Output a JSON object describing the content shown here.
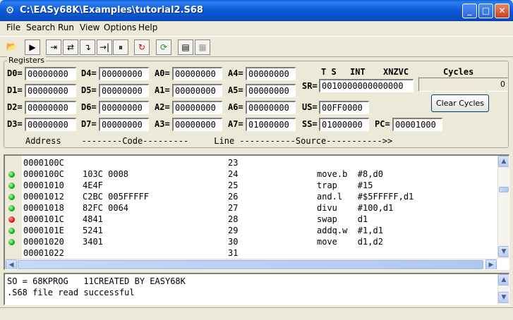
{
  "window": {
    "title": "C:\\EASy68K\\Examples\\tutorial2.S68",
    "icon": "gear-icon",
    "controls": {
      "minimize": "_",
      "maximize": "□",
      "close": "✕"
    }
  },
  "menu": [
    "File",
    "Search",
    "Run",
    "View",
    "Options",
    "Help"
  ],
  "toolbar": {
    "icons": [
      "open-folder-icon",
      "run-icon",
      "step-into-icon",
      "step-over-icon",
      "trace-into-icon",
      "run-to-cursor-icon",
      "pause-icon",
      "reset-icon",
      "reload-icon",
      "log-icon",
      "log-stop-icon"
    ],
    "glyphs": [
      "📂",
      "▶",
      "⇥",
      "⇄",
      "↴",
      "→|",
      "⏸",
      "↻",
      "⟳",
      "▤",
      "▦"
    ]
  },
  "registers": {
    "group_label": "Registers",
    "D0": {
      "label": "D0=",
      "value": "00000000"
    },
    "D1": {
      "label": "D1=",
      "value": "00000000"
    },
    "D2": {
      "label": "D2=",
      "value": "00000000"
    },
    "D3": {
      "label": "D3=",
      "value": "00000000"
    },
    "D4": {
      "label": "D4=",
      "value": "00000000"
    },
    "D5": {
      "label": "D5=",
      "value": "00000000"
    },
    "D6": {
      "label": "D6=",
      "value": "00000000"
    },
    "D7": {
      "label": "D7=",
      "value": "00000000"
    },
    "A0": {
      "label": "A0=",
      "value": "00000000"
    },
    "A1": {
      "label": "A1=",
      "value": "00000000"
    },
    "A2": {
      "label": "A2=",
      "value": "00000000"
    },
    "A3": {
      "label": "A3=",
      "value": "00000000"
    },
    "A4": {
      "label": "A4=",
      "value": "00000000"
    },
    "A5": {
      "label": "A5=",
      "value": "00000000"
    },
    "A6": {
      "label": "A6=",
      "value": "00000000"
    },
    "A7": {
      "label": "A7=",
      "value": "01000000"
    },
    "SR": {
      "label": "SR=",
      "value": "0010000000000000"
    },
    "US": {
      "label": "US=",
      "value": "00FF0000"
    },
    "SS": {
      "label": "SS=",
      "value": "01000000"
    },
    "PC": {
      "label": "PC=",
      "value": "00001000"
    },
    "sr_header": {
      "ts": "T S",
      "int": "INT",
      "flags": "XNZVC"
    }
  },
  "cycles": {
    "label": "Cycles",
    "value": "0",
    "clear_button": "Clear Cycles"
  },
  "listing": {
    "column_header": "Address    --------Code---------     Line -----------Source----------->>",
    "rows": [
      {
        "addr": "0000100C",
        "code": "",
        "line": "23",
        "source": "",
        "marker": ""
      },
      {
        "addr": "0000100C",
        "code": "103C 0008",
        "line": "24",
        "source": "move.b  #8,d0",
        "marker": "green"
      },
      {
        "addr": "00001010",
        "code": "4E4F",
        "line": "25",
        "source": "trap    #15",
        "marker": "green"
      },
      {
        "addr": "00001012",
        "code": "C2BC 005FFFFF",
        "line": "26",
        "source": "and.l   #$5FFFFF,d1",
        "marker": "green"
      },
      {
        "addr": "00001018",
        "code": "82FC 0064",
        "line": "27",
        "source": "divu    #100,d1",
        "marker": "green"
      },
      {
        "addr": "0000101C",
        "code": "4841",
        "line": "28",
        "source": "swap    d1",
        "marker": "red"
      },
      {
        "addr": "0000101E",
        "code": "5241",
        "line": "29",
        "source": "addq.w  #1,d1",
        "marker": "green"
      },
      {
        "addr": "00001020",
        "code": "3401",
        "line": "30",
        "source": "move    d1,d2",
        "marker": "green"
      },
      {
        "addr": "00001022",
        "code": "",
        "line": "31",
        "source": "",
        "marker": ""
      }
    ]
  },
  "messages": [
    "SO = 68KPROG   11CREATED BY EASY68K",
    ".S68 file read successful"
  ],
  "scroll": {
    "listing_vertical_position": 0.2,
    "listing_horizontal_position": 0.0,
    "messages_vertical_position": 0.0
  }
}
